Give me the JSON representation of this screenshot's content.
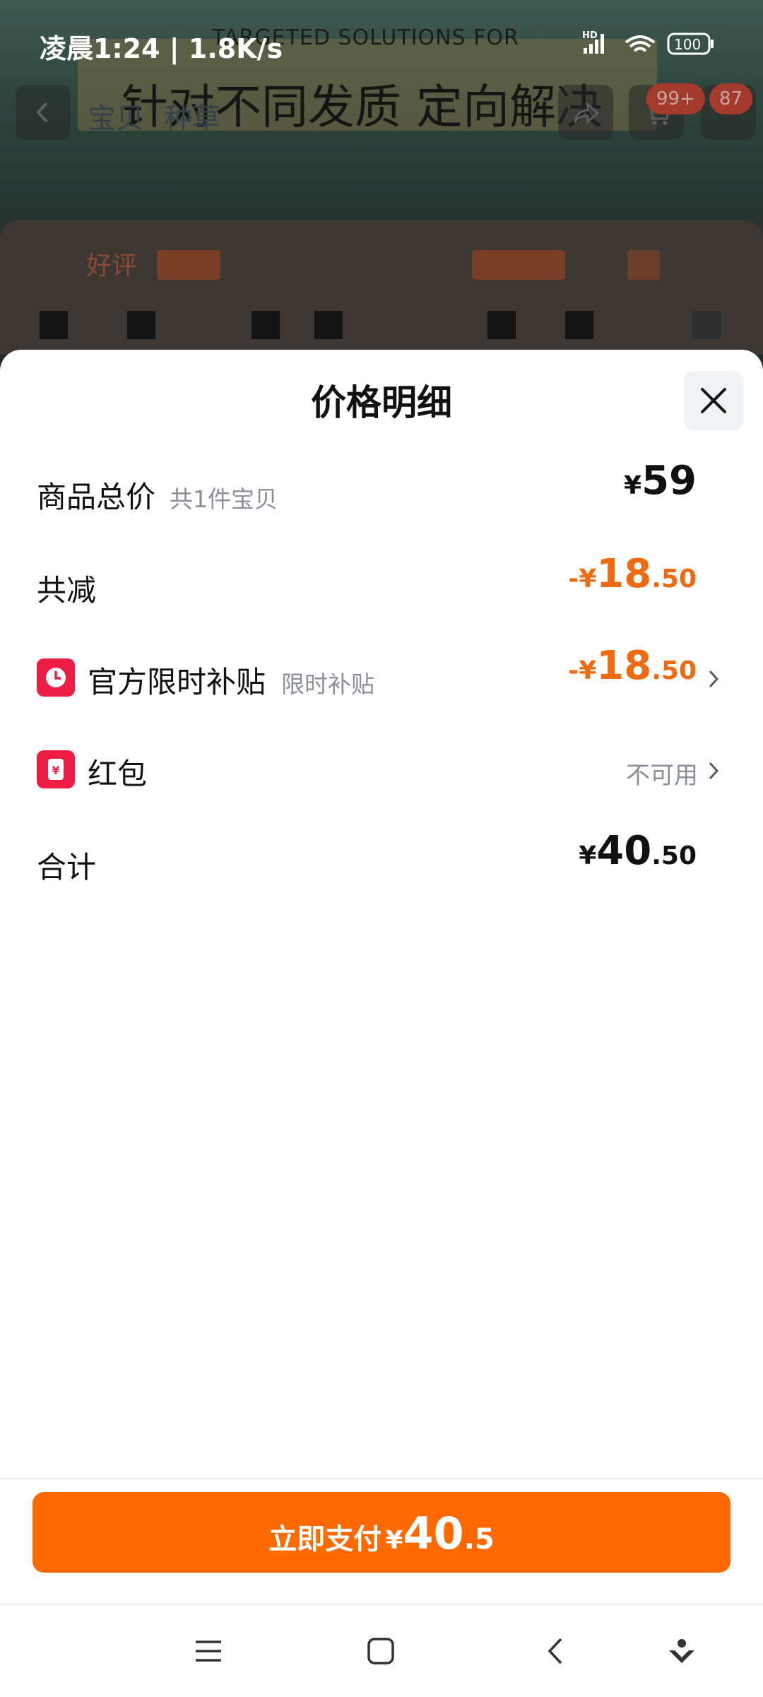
{
  "status_bar": {
    "time": "凌晨1:24",
    "speed": "1.8K/s",
    "network": "HD",
    "battery": "100"
  },
  "background_page": {
    "banner_en": "TARGETED SOLUTIONS FOR",
    "banner_zh": "针对不同发质 定向解决",
    "tabs": [
      "宝贝",
      "种草"
    ],
    "cart_badge": "99+",
    "more_badge": "87",
    "review_label": "好评"
  },
  "price_sheet": {
    "title": "价格明细",
    "rows": {
      "total": {
        "label": "商品总价",
        "sublabel": "共1件宝贝",
        "currency": "¥",
        "integer": "59",
        "decimal": ""
      },
      "reduction": {
        "label": "共减",
        "prefix": "-¥",
        "integer": "18",
        "decimal": ".50"
      },
      "subsidy": {
        "label": "官方限时补贴",
        "sublabel": "限时补贴",
        "prefix": "-¥",
        "integer": "18",
        "decimal": ".50"
      },
      "red_packet": {
        "label": "红包",
        "status": "不可用"
      },
      "sum": {
        "label": "合计",
        "currency": "¥",
        "integer": "40",
        "decimal": ".50"
      }
    }
  },
  "pay_button": {
    "label": "立即支付",
    "currency": "¥",
    "integer": "40",
    "decimal": ".5"
  },
  "colors": {
    "accent_orange": "#ff6a00",
    "discount_text": "#f06a12",
    "icon_red": "#ee1d45"
  }
}
